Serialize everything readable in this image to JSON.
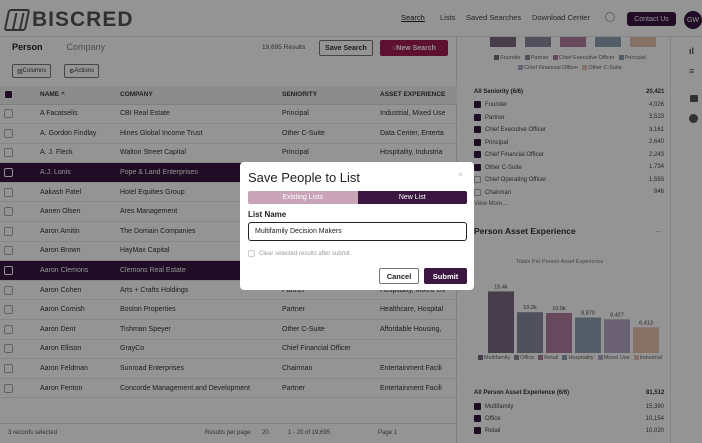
{
  "brand": {
    "name": "BISCRED"
  },
  "topnav": {
    "search": "Search",
    "lists": "Lists",
    "saved_searches": "Saved Searches",
    "download_center": "Download Center",
    "contact": "Contact Us",
    "avatar": "GW"
  },
  "tabs": {
    "person": "Person",
    "company": "Company"
  },
  "toolbar": {
    "results": "19,695 Results",
    "save_search": "Save Search",
    "new_search": "New Search",
    "columns": "Columns",
    "actions": "Actions"
  },
  "table": {
    "headers": {
      "name": "NAME ^",
      "company": "COMPANY",
      "seniority": "SENIORITY",
      "asset": "ASSET EXPERIENCE"
    },
    "rows": [
      {
        "name": "A Facatselis",
        "company": "CBI Real Estate",
        "seniority": "Principal",
        "asset": "Industrial, Mixed Use",
        "selected": false
      },
      {
        "name": "A. Gordon Findlay",
        "company": "Hines Global Income Trust",
        "seniority": "Other C-Suite",
        "asset": "Data Center, Enterta",
        "selected": false
      },
      {
        "name": "A. J. Fleck",
        "company": "Walton Street Capital",
        "seniority": "Principal",
        "asset": "Hospitality, Industria",
        "selected": false
      },
      {
        "name": "A.J. Lonis",
        "company": "Pope & Land Enterprises",
        "seniority": "",
        "asset": "",
        "selected": true
      },
      {
        "name": "Aakash Patel",
        "company": "Hotel Equities Group",
        "seniority": "",
        "asset": "",
        "selected": false
      },
      {
        "name": "Aanen Olsen",
        "company": "Ares Management",
        "seniority": "",
        "asset": "",
        "selected": false
      },
      {
        "name": "Aaron Amitin",
        "company": "The Domain Companies",
        "seniority": "",
        "asset": "",
        "selected": false
      },
      {
        "name": "Aaron Brown",
        "company": "HayMax Capital",
        "seniority": "",
        "asset": "",
        "selected": false
      },
      {
        "name": "Aaron Clemons",
        "company": "Clemons Real Estate",
        "seniority": "",
        "asset": "",
        "selected": true
      },
      {
        "name": "Aaron Cohen",
        "company": "Arts + Crafts Holdings",
        "seniority": "Partner",
        "asset": "Hospitality, Mixed Us",
        "selected": false
      },
      {
        "name": "Aaron Cornish",
        "company": "Boston Properties",
        "seniority": "Partner",
        "asset": "Healthcare, Hospital",
        "selected": false
      },
      {
        "name": "Aaron Dent",
        "company": "Tishman Speyer",
        "seniority": "Other C-Suite",
        "asset": "Affordable Housing,",
        "selected": false
      },
      {
        "name": "Aaron Ellison",
        "company": "GrayCo",
        "seniority": "Chief Financial Officer",
        "asset": "",
        "selected": false
      },
      {
        "name": "Aaron Feldman",
        "company": "Sunroad Enterprises",
        "seniority": "Chairman",
        "asset": "Entertainment Facili",
        "selected": false
      },
      {
        "name": "Aaron Fenton",
        "company": "Concorde Management and Development",
        "seniority": "Partner",
        "asset": "Entertainment Facili",
        "selected": false
      }
    ]
  },
  "footer": {
    "selected": "3 records selected",
    "per_page_label": "Results per page:",
    "per_page": "20",
    "range": "1 - 20 of 19,695",
    "page": "Page 1"
  },
  "right": {
    "top_legend": [
      "Founder",
      "Partner",
      "Chief Executive Officer",
      "Principal",
      "Chief Financial Officer",
      "Other C-Suite"
    ],
    "seniority_title": "All Seniority (6/6)",
    "seniority_total": "20,421",
    "seniority": [
      {
        "label": "Founder",
        "count": "4,026",
        "checked": true
      },
      {
        "label": "Partner",
        "count": "3,523",
        "checked": true
      },
      {
        "label": "Chief Executive Officer",
        "count": "3,161",
        "checked": true
      },
      {
        "label": "Principal",
        "count": "2,640",
        "checked": true
      },
      {
        "label": "Chief Financial Officer",
        "count": "2,243",
        "checked": true
      },
      {
        "label": "Other C-Suite",
        "count": "1,734",
        "checked": true
      },
      {
        "label": "Chief Operating Officer",
        "count": "1,593",
        "checked": false
      },
      {
        "label": "Chairman",
        "count": "846",
        "checked": false
      }
    ],
    "view_more": "View More...",
    "asset_section": "Person Asset Experience",
    "chart_title": "Totals Per Person Asset Experience",
    "chart_legend": [
      "Multifamily",
      "Office",
      "Retail",
      "Hospitality",
      "Mixed Use",
      "Industrial"
    ],
    "asset_filter_title": "All Person Asset Experience (6/6)",
    "asset_total": "81,512",
    "assets": [
      {
        "label": "Multifamily",
        "count": "15,390"
      },
      {
        "label": "Office",
        "count": "10,154"
      },
      {
        "label": "Retail",
        "count": "10,020"
      }
    ]
  },
  "chart_data": {
    "type": "bar",
    "title": "Totals Per Person Asset Experience",
    "categories": [
      "Multifamily",
      "Office",
      "Retail",
      "Hospitality",
      "Mixed Use",
      "Industrial"
    ],
    "values": [
      15400,
      10200,
      10000,
      8870,
      8427,
      6413
    ],
    "value_labels": [
      "15.4k",
      "10.2k",
      "10.0k",
      "8,870",
      "8,427",
      "6,413"
    ],
    "ylim": [
      0,
      20000
    ],
    "colors": [
      "#7a6a82",
      "#8c8aa0",
      "#b07ea0",
      "#8da0b4",
      "#b8a8c8",
      "#e8c2b0"
    ]
  },
  "modal": {
    "title": "Save People to List",
    "close": "×",
    "tab_existing": "Existing Lists",
    "tab_new": "New List",
    "field_label": "List Name",
    "field_value": "Multifamily Decision Makers",
    "clear_label": "Clear selected results after submit.",
    "cancel": "Cancel",
    "submit": "Submit"
  }
}
